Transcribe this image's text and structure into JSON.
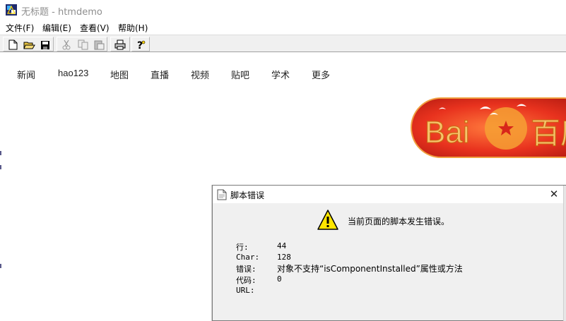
{
  "window": {
    "title": "无标题 - htmdemo",
    "title_color": "#8e8e8e"
  },
  "menu": {
    "items": [
      {
        "label": "文件(F)"
      },
      {
        "label": "编辑(E)"
      },
      {
        "label": "查看(V)"
      },
      {
        "label": "帮助(H)"
      }
    ]
  },
  "toolbar": {
    "buttons": [
      {
        "icon": "new-document-icon"
      },
      {
        "icon": "open-folder-icon"
      },
      {
        "icon": "save-disk-icon"
      },
      {
        "icon": "cut-icon"
      },
      {
        "icon": "copy-icon"
      },
      {
        "icon": "paste-icon"
      },
      {
        "icon": "print-icon"
      },
      {
        "icon": "help-question-icon"
      }
    ]
  },
  "page": {
    "nav_links": [
      "新闻",
      "hao123",
      "地图",
      "直播",
      "视频",
      "贴吧",
      "学术",
      "更多"
    ],
    "logo": {
      "text_latin": "Bai",
      "text_cn": "百度",
      "colors": {
        "red": "#e8321e",
        "gold": "#f6c36c",
        "dark_red": "#b81d12"
      }
    }
  },
  "dialog": {
    "title": "脚本错误",
    "close_glyph": "✕",
    "message": "当前页面的脚本发生错误。",
    "rows": [
      {
        "label": "行:",
        "value": "44"
      },
      {
        "label": "Char:",
        "value": "128"
      },
      {
        "label": "错误:",
        "value": "对象不支持“isComponentInstalled”属性或方法"
      },
      {
        "label": "代码:",
        "value": "0"
      },
      {
        "label": "URL:",
        "value": ""
      }
    ],
    "warning_color": "#ffe600"
  }
}
